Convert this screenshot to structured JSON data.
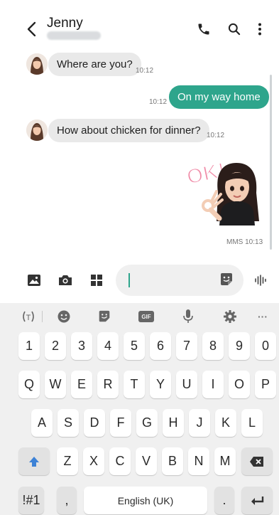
{
  "header": {
    "title": "Jenny"
  },
  "messages": {
    "m1": {
      "text": "Where are you?",
      "time": "10:12"
    },
    "m2": {
      "text": "On my way home",
      "time": "10:12"
    },
    "m3": {
      "text": "How about chicken for dinner?",
      "time": "10:12"
    },
    "m4": {
      "sticker_text": "OK!",
      "time": "MMS 10:13"
    }
  },
  "keyboard": {
    "numbers": [
      "1",
      "2",
      "3",
      "4",
      "5",
      "6",
      "7",
      "8",
      "9",
      "0"
    ],
    "row1": [
      "Q",
      "W",
      "E",
      "R",
      "T",
      "Y",
      "U",
      "I",
      "O",
      "P"
    ],
    "row2": [
      "A",
      "S",
      "D",
      "F",
      "G",
      "H",
      "J",
      "K",
      "L"
    ],
    "row3": [
      "Z",
      "X",
      "C",
      "V",
      "B",
      "N",
      "M"
    ],
    "symbols": "!#1",
    "comma": ",",
    "space": "English (UK)",
    "period": ".",
    "gif": "GIF",
    "more": "···"
  },
  "colors": {
    "accent": "#2ea58c",
    "bubble_in": "#e9e9e9",
    "shift": "#3d82d6"
  },
  "icons": {
    "header": [
      "back-icon",
      "phone-icon",
      "search-icon",
      "more-vert-icon"
    ],
    "composer": [
      "gallery-icon",
      "camera-icon",
      "apps-icon",
      "sticker-icon",
      "voice-icon"
    ],
    "toolbar": [
      "text-mode-icon",
      "emoji-icon",
      "sticker-icon",
      "gif-icon",
      "mic-icon",
      "settings-icon",
      "more-icon"
    ]
  }
}
